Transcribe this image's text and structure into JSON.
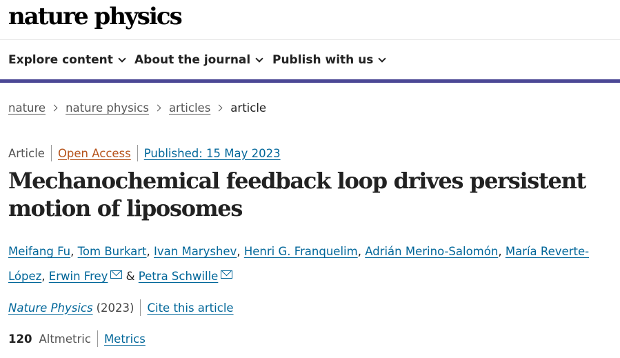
{
  "header": {
    "logo_text": "nature physics"
  },
  "nav": {
    "items": [
      {
        "label": "Explore content"
      },
      {
        "label": "About the journal"
      },
      {
        "label": "Publish with us"
      }
    ]
  },
  "breadcrumb": {
    "items": [
      "nature",
      "nature physics",
      "articles"
    ],
    "current": "article"
  },
  "article": {
    "type": "Article",
    "access": "Open Access",
    "published": "Published: 15 May 2023",
    "title": "Mechanochemical feedback loop drives persistent motion of liposomes",
    "authors": [
      "Meifang Fu",
      "Tom Burkart",
      "Ivan Maryshev",
      "Henri G. Franquelim",
      "Adrián Merino-Salomón",
      "María Reverte-López",
      "Erwin Frey",
      "Petra Schwille"
    ],
    "authors_and": "&",
    "journal": "Nature Physics",
    "year": "(2023)",
    "cite_label": "Cite this article",
    "altmetric_count": "120",
    "altmetric_label": "Altmetric",
    "metrics_label": "Metrics"
  },
  "colors": {
    "nav_border": "#4b4795",
    "link": "#006699",
    "open_access": "#b6531b"
  }
}
